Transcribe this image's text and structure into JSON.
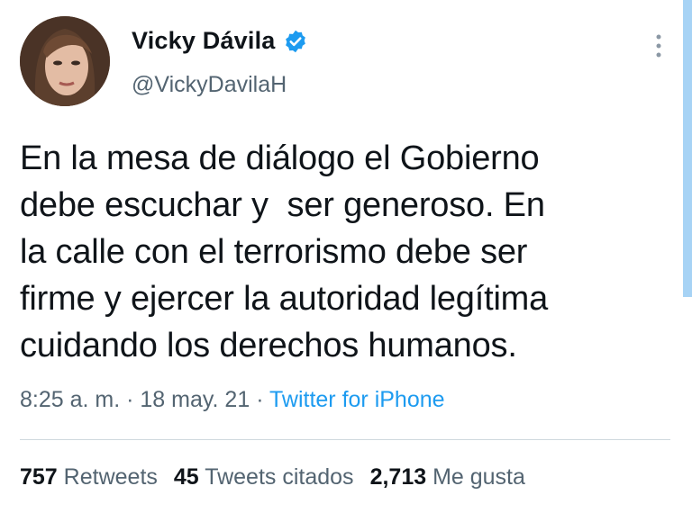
{
  "author": {
    "display_name": "Vicky Dávila",
    "handle": "@VickyDavilaH",
    "verified": true
  },
  "tweet": {
    "text": "En la mesa de diálogo el Gobierno\ndebe escuchar y  ser generoso. En\nla calle con el terrorismo debe ser\nfirme y ejercer la autoridad legítima\ncuidando los derechos humanos."
  },
  "meta": {
    "time": "8:25 a. m.",
    "separator": "·",
    "date": "18 may. 21",
    "source": "Twitter for iPhone"
  },
  "stats": {
    "retweets_count": "757",
    "retweets_label": "Retweets",
    "quotes_count": "45",
    "quotes_label": "Tweets citados",
    "likes_count": "2,713",
    "likes_label": "Me gusta"
  },
  "colors": {
    "text": "#0f1419",
    "secondary": "#536471",
    "link": "#1d9bf0",
    "verified": "#1d9bf0"
  }
}
